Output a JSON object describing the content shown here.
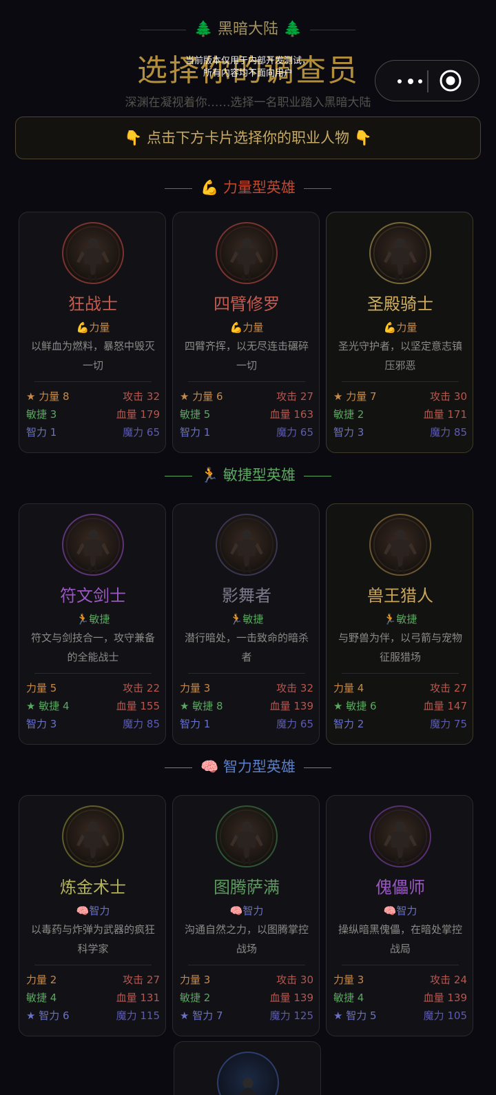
{
  "header": {
    "top_label": "🌲 黑暗大陆 🌲",
    "title": "选择你的调查员",
    "dev_notice_line1": "当前版本仅用于内部开发测试，",
    "dev_notice_line2": "所有内容均不面向用户",
    "subtitle": "深渊在凝视着你……选择一名职业踏入黑暗大陆"
  },
  "hint": "👇 点击下方卡片选择你的职业人物 👇",
  "sections": [
    {
      "title": "💪 力量型英雄",
      "color": "#c0492f",
      "cards": [
        {
          "name": "狂战士",
          "name_color": "#c55b4e",
          "type": "💪力量",
          "type_color": "#c98a48",
          "desc": "以鲜血为燃料，暴怒中毁灭一切",
          "str": "★ 力量 8",
          "agi": "敏捷 3",
          "int": "智力 1",
          "atk": "攻击 32",
          "hp": "血量 179",
          "mp": "魔力 65",
          "avatar_color": "#7a3330"
        },
        {
          "name": "四臂修罗",
          "name_color": "#c55b4e",
          "type": "💪力量",
          "type_color": "#c98a48",
          "desc": "四臂齐挥，以无尽连击碾碎一切",
          "str": "★ 力量 6",
          "agi": "敏捷 5",
          "int": "智力 1",
          "atk": "攻击 27",
          "hp": "血量 163",
          "mp": "魔力 65",
          "avatar_color": "#7a3330"
        },
        {
          "name": "圣殿骑士",
          "name_color": "#d1ae5c",
          "type": "💪力量",
          "type_color": "#c98a48",
          "desc": "圣光守护者，以坚定意志镇压邪恶",
          "str": "★ 力量 7",
          "agi": "敏捷 2",
          "int": "智力 3",
          "atk": "攻击 30",
          "hp": "血量 171",
          "mp": "魔力 85",
          "avatar_color": "#76663a"
        }
      ]
    },
    {
      "title": "🏃 敏捷型英雄",
      "color": "#5ba860",
      "cards": [
        {
          "name": "符文剑士",
          "name_color": "#9a58c2",
          "type": "🏃敏捷",
          "type_color": "#5ba860",
          "desc": "符文与剑技合一，攻守兼备的全能战士",
          "str": "力量 5",
          "agi": "★ 敏捷 4",
          "int": "智力 3",
          "atk": "攻击 22",
          "hp": "血量 155",
          "mp": "魔力 85",
          "avatar_color": "#5d3478"
        },
        {
          "name": "影舞者",
          "name_color": "#7d7a8c",
          "type": "🏃敏捷",
          "type_color": "#5ba860",
          "desc": "潜行暗处，一击致命的暗杀者",
          "str": "力量 3",
          "agi": "★ 敏捷 8",
          "int": "智力 1",
          "atk": "攻击 32",
          "hp": "血量 139",
          "mp": "魔力 65",
          "avatar_color": "#3a3550"
        },
        {
          "name": "兽王猎人",
          "name_color": "#c9a45c",
          "type": "🏃敏捷",
          "type_color": "#5ba860",
          "desc": "与野兽为伴，以弓箭与宠物征服猎场",
          "str": "力量 4",
          "agi": "★ 敏捷 6",
          "int": "智力 2",
          "atk": "攻击 27",
          "hp": "血量 147",
          "mp": "魔力 75",
          "avatar_color": "#6a5530"
        }
      ]
    },
    {
      "title": "🧠 智力型英雄",
      "color": "#5a7fc8",
      "cards": [
        {
          "name": "炼金术士",
          "name_color": "#b3b35a",
          "type": "🧠智力",
          "type_color": "#6a72c8",
          "desc": "以毒药与炸弹为武器的疯狂科学家",
          "str": "力量 2",
          "agi": "敏捷 4",
          "int": "★ 智力 6",
          "atk": "攻击 27",
          "hp": "血量 131",
          "mp": "魔力 115",
          "avatar_color": "#5f5d2a"
        },
        {
          "name": "图腾萨满",
          "name_color": "#5e9a5f",
          "type": "🧠智力",
          "type_color": "#6a72c8",
          "desc": "沟通自然之力，以图腾掌控战场",
          "str": "力量 3",
          "agi": "敏捷 2",
          "int": "★ 智力 7",
          "atk": "攻击 30",
          "hp": "血量 139",
          "mp": "魔力 125",
          "avatar_color": "#2f5534"
        },
        {
          "name": "傀儡师",
          "name_color": "#9a58c2",
          "type": "🧠智力",
          "type_color": "#6a72c8",
          "desc": "操纵暗黑傀儡，在暗处掌控战局",
          "str": "力量 3",
          "agi": "敏捷 4",
          "int": "★ 智力 5",
          "atk": "攻击 24",
          "hp": "血量 139",
          "mp": "魔力 105",
          "avatar_color": "#553070"
        }
      ]
    }
  ],
  "extra_card": {
    "avatar_color": "#2b3f6a"
  }
}
